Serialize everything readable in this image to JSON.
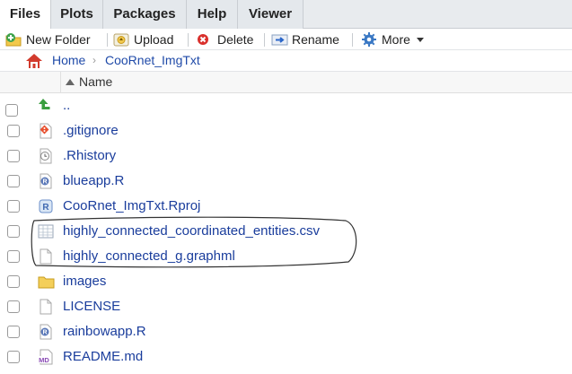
{
  "tabs": [
    {
      "label": "Files",
      "active": true
    },
    {
      "label": "Plots",
      "active": false
    },
    {
      "label": "Packages",
      "active": false
    },
    {
      "label": "Help",
      "active": false
    },
    {
      "label": "Viewer",
      "active": false
    }
  ],
  "toolbar": {
    "new_folder": "New Folder",
    "upload": "Upload",
    "delete": "Delete",
    "rename": "Rename",
    "more": "More"
  },
  "breadcrumb": {
    "home": "Home",
    "folder": "CooRnet_ImgTxt"
  },
  "table": {
    "column_name": "Name"
  },
  "files": [
    {
      "name": "..",
      "icon": "up-arrow-icon"
    },
    {
      "name": ".gitignore",
      "icon": "git-file-icon"
    },
    {
      "name": ".Rhistory",
      "icon": "history-file-icon"
    },
    {
      "name": "blueapp.R",
      "icon": "r-script-icon"
    },
    {
      "name": "CooRnet_ImgTxt.Rproj",
      "icon": "rproj-icon"
    },
    {
      "name": "highly_connected_coordinated_entities.csv",
      "icon": "csv-file-icon"
    },
    {
      "name": "highly_connected_g.graphml",
      "icon": "blank-file-icon"
    },
    {
      "name": "images",
      "icon": "folder-icon"
    },
    {
      "name": "LICENSE",
      "icon": "blank-file-icon"
    },
    {
      "name": "rainbowapp.R",
      "icon": "r-script-icon"
    },
    {
      "name": "README.md",
      "icon": "markdown-file-icon"
    }
  ],
  "colors": {
    "link": "#1a3d9c",
    "tabbar": "#e8ebee"
  }
}
